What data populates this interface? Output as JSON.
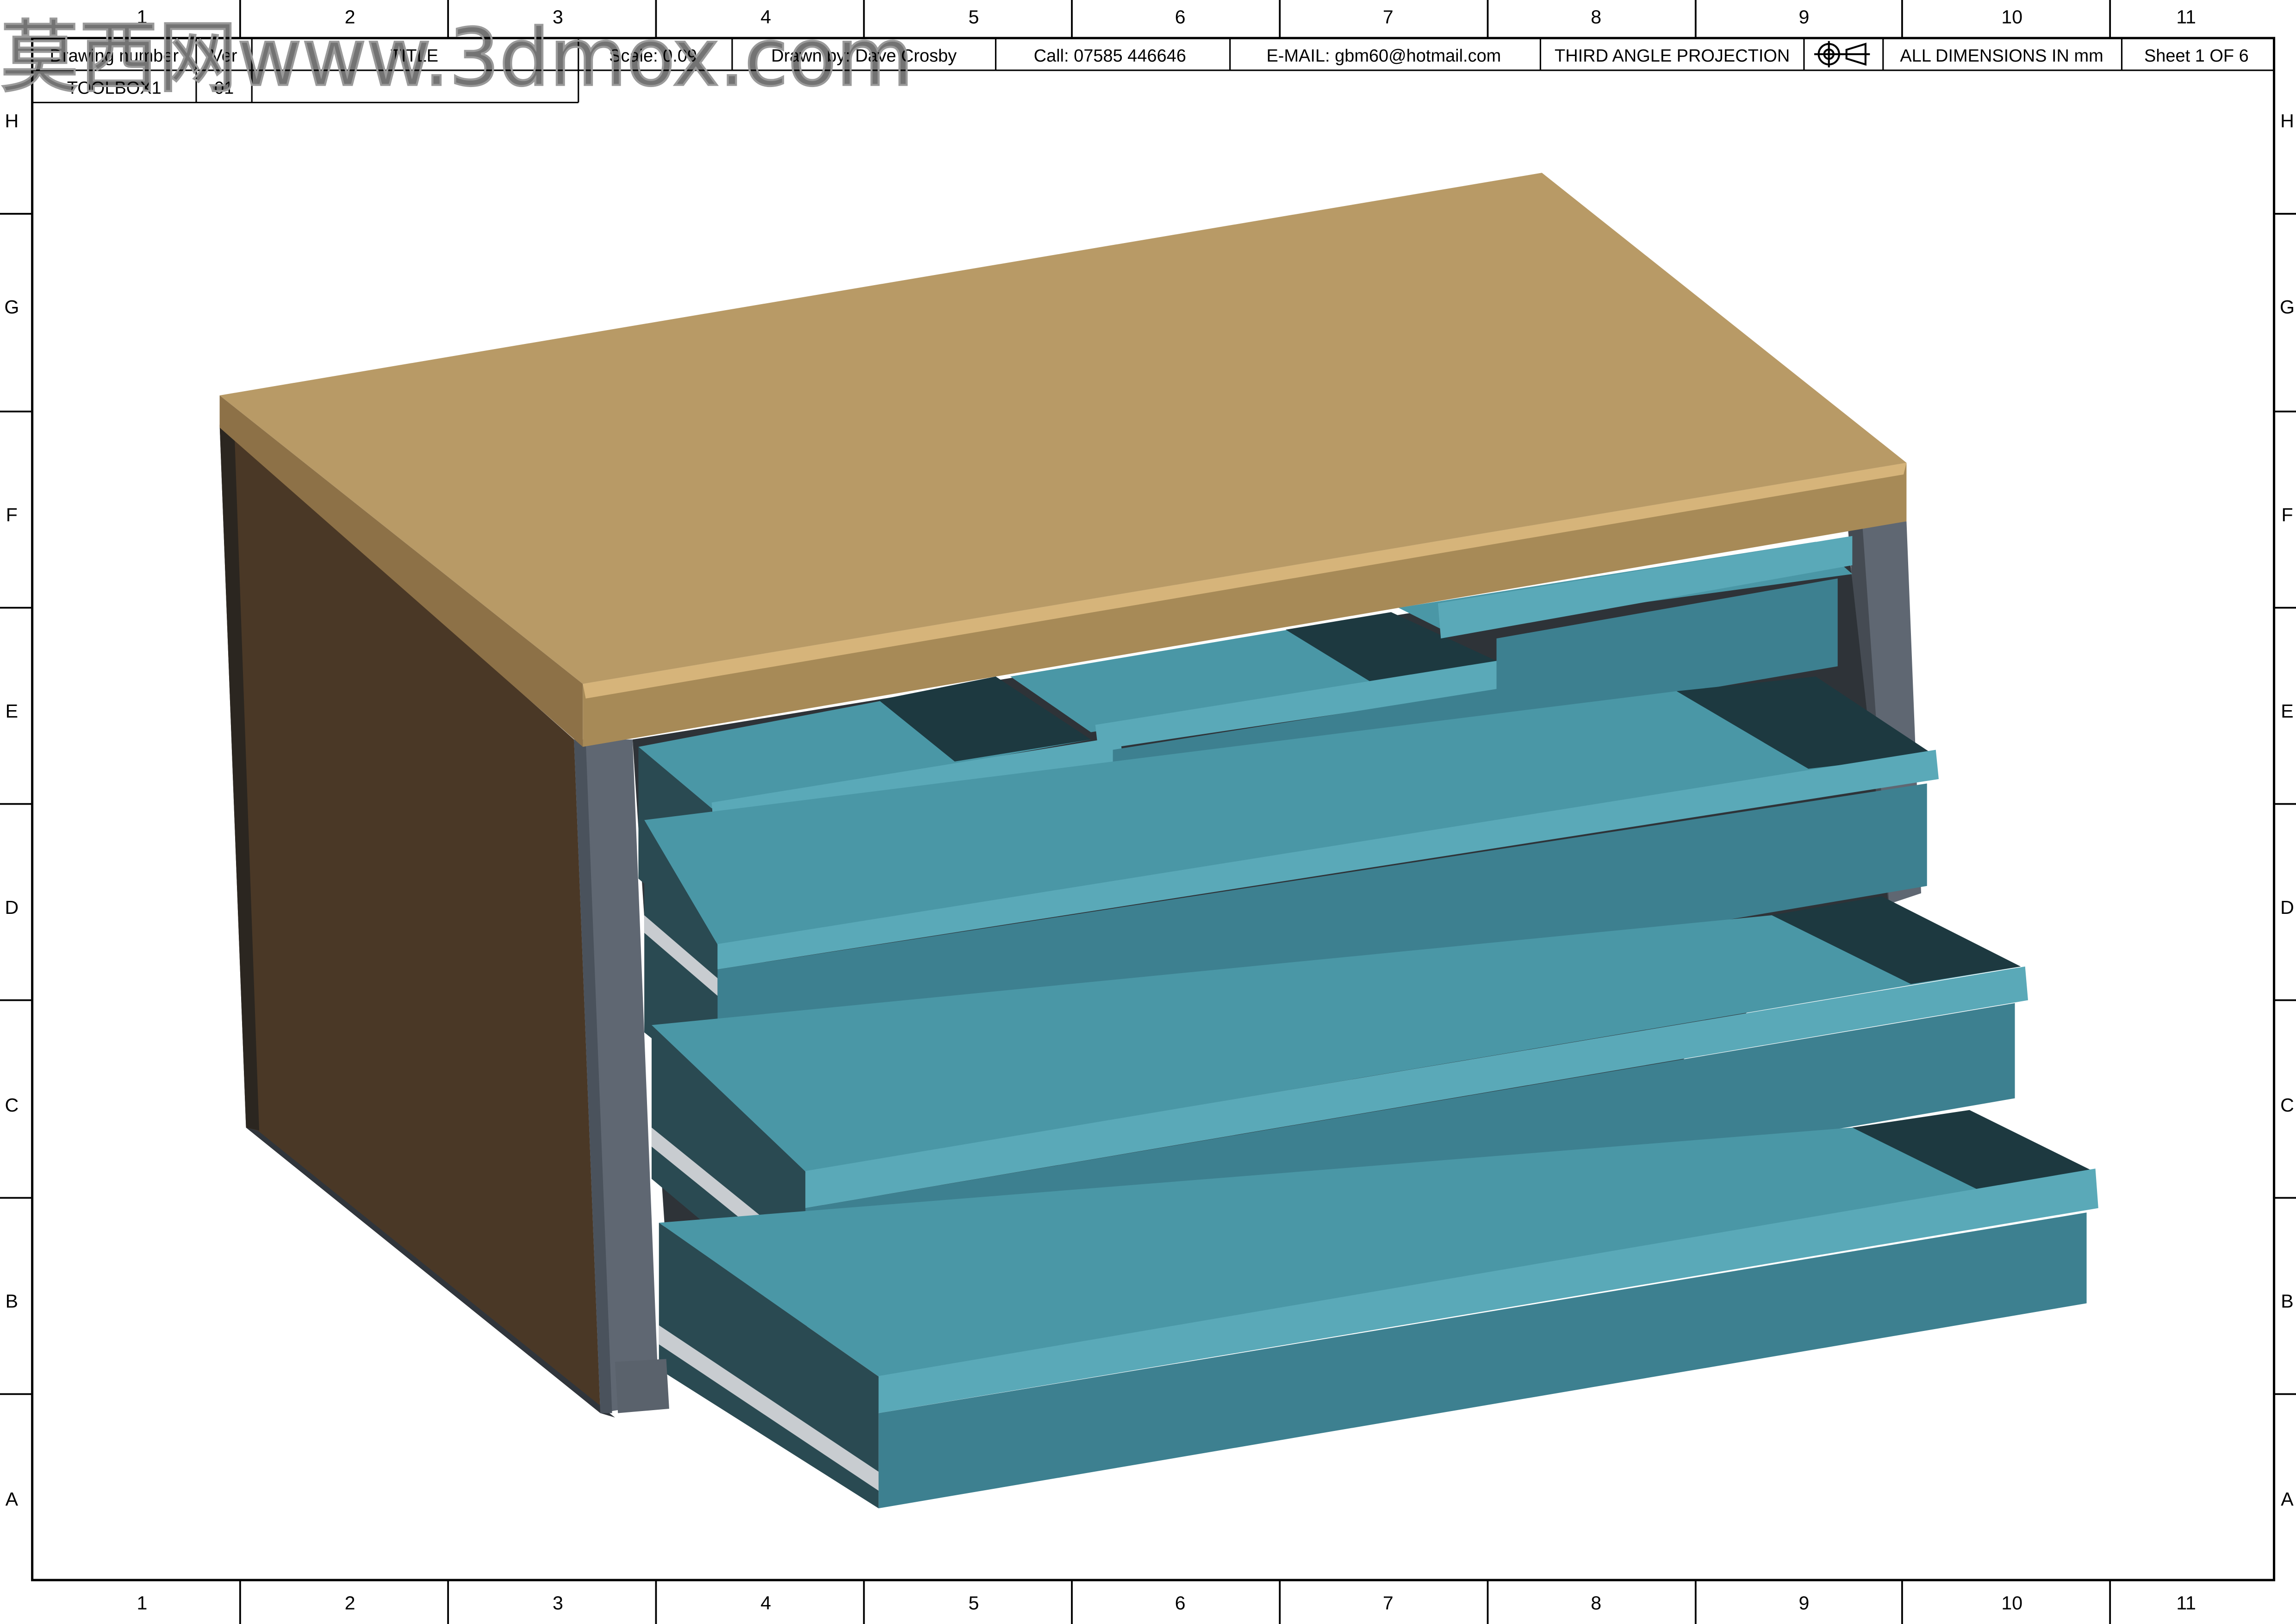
{
  "watermark": "莫西网www.3dmox.com",
  "grid": {
    "columns": [
      "1",
      "2",
      "3",
      "4",
      "5",
      "6",
      "7",
      "8",
      "9",
      "10",
      "11"
    ],
    "rows": [
      "H",
      "G",
      "F",
      "E",
      "D",
      "C",
      "B",
      "A"
    ]
  },
  "title_block": {
    "drawing_number_label": "Drawing number",
    "drawing_number": "TOOLBOX1",
    "version_label": "Ver",
    "version": "01",
    "title_label": "TITLE",
    "title": "",
    "scale": "Scale: 0.09",
    "drawn_by": "Drawn by: Dave Crosby",
    "phone": "Call: 07585 446646",
    "email": "E-MAIL: gbm60@hotmail.com",
    "projection": "THIRD ANGLE PROJECTION",
    "projection_symbol": "third-angle-projection-symbol",
    "dimensions": "ALL DIMENSIONS IN mm",
    "sheet": "Sheet 1 OF 6"
  },
  "drawing": {
    "subject": "toolbox",
    "drawers_open": 5,
    "colors": {
      "worktop_top": "#b89a66",
      "worktop_edge": "#c9a76d",
      "side_panel": "#4a3826",
      "frame": "#5f6772",
      "drawer_front": "#3d8090",
      "drawer_floor": "#4a97a6",
      "drawer_lip": "#5aa9b8",
      "drawer_interior": "#1d3940",
      "runner": "#c8ccd0"
    }
  }
}
